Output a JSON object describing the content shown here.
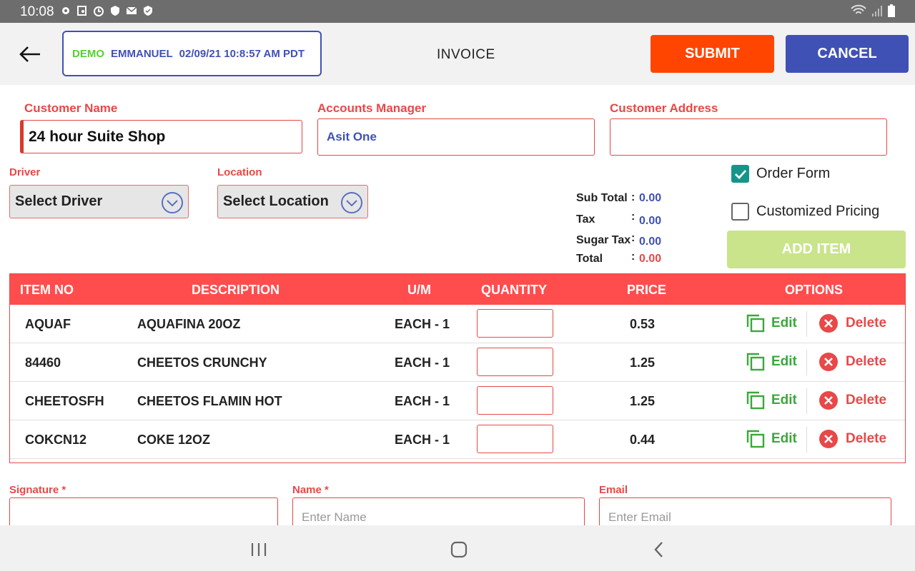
{
  "status_bar": {
    "time": "10:08"
  },
  "header": {
    "env": "DEMO",
    "user": "EMMANUEL",
    "datetime": "02/09/21 10:8:57 AM PDT",
    "title": "INVOICE",
    "submit_label": "SUBMIT",
    "cancel_label": "CANCEL"
  },
  "form": {
    "customer_name_label": "Customer Name",
    "customer_name_value": "24 hour Suite Shop",
    "accounts_manager_label": "Accounts Manager",
    "accounts_manager_value": "Asit One",
    "customer_address_label": "Customer Address",
    "customer_address_value": "",
    "driver_label": "Driver",
    "driver_value": "Select Driver",
    "location_label": "Location",
    "location_value": "Select Location"
  },
  "totals": {
    "subtotal_label": "Sub Total",
    "subtotal": "0.00",
    "tax_label": "Tax",
    "tax": "0.00",
    "sugar_tax_label": "Sugar Tax",
    "sugar_tax": "0.00",
    "total_label": "Total",
    "total": "0.00",
    "colon": ":"
  },
  "options": {
    "order_form_label": "Order Form",
    "order_form_checked": true,
    "custom_pricing_label": "Customized Pricing",
    "custom_pricing_checked": false,
    "add_item_label": "ADD ITEM"
  },
  "table": {
    "headers": [
      "ITEM NO",
      "DESCRIPTION",
      "U/M",
      "QUANTITY",
      "PRICE",
      "OPTIONS"
    ],
    "edit_label": "Edit",
    "delete_label": "Delete",
    "rows": [
      {
        "item_no": "AQUAF",
        "description": "AQUAFINA 20OZ",
        "um": "EACH - 1",
        "quantity": "",
        "price": "0.53"
      },
      {
        "item_no": "84460",
        "description": "CHEETOS CRUNCHY",
        "um": "EACH - 1",
        "quantity": "",
        "price": "1.25"
      },
      {
        "item_no": "CHEETOSFH",
        "description": "CHEETOS FLAMIN HOT",
        "um": "EACH - 1",
        "quantity": "",
        "price": "1.25"
      },
      {
        "item_no": "COKCN12",
        "description": "COKE 12OZ",
        "um": "EACH - 1",
        "quantity": "",
        "price": "0.44"
      }
    ]
  },
  "signoff": {
    "signature_label": "Signature  *",
    "name_label": "Name  *",
    "name_placeholder": "Enter Name",
    "email_label": "Email",
    "email_placeholder": "Enter Email"
  },
  "colors": {
    "accent_red": "#e84848",
    "header_red": "#ff4d4d",
    "submit_orange": "#ff4500",
    "brand_blue": "#3f51b5",
    "demo_green": "#55d12e",
    "teal": "#15958a",
    "add_item_green": "#c9e48a"
  }
}
